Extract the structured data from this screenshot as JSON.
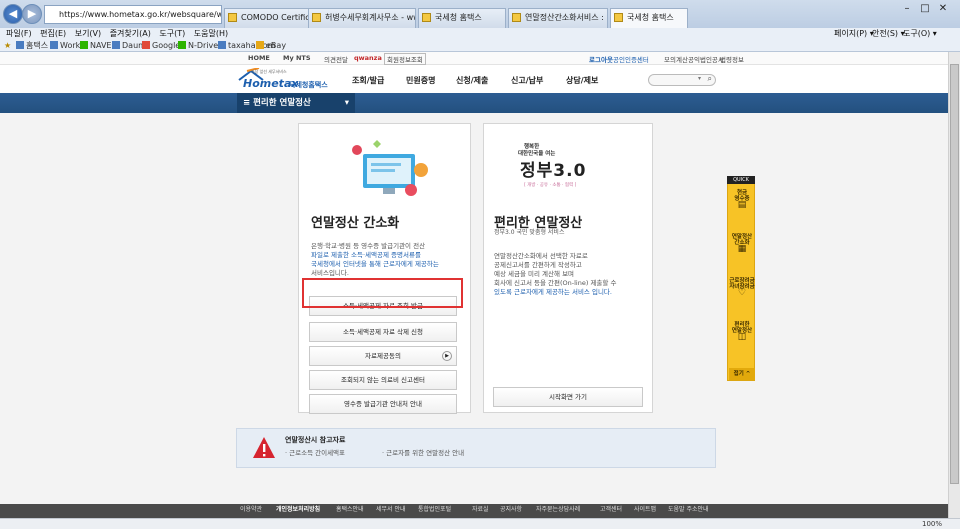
{
  "browser": {
    "address": "https://www.hometax.go.kr/websquare/websquare.wq?w",
    "tabs": [
      {
        "label": "COMODO Certification ..."
      },
      {
        "label": "허병수세무회계사무소 - www...."
      },
      {
        "label": "국세청 홈택스"
      },
      {
        "label": "연말정산간소화서비스 : 네이..."
      },
      {
        "label": "국세청 홈택스"
      }
    ],
    "menus": [
      "파일(F)",
      "편집(E)",
      "보기(V)",
      "즐겨찾기(A)",
      "도구(T)",
      "도움말(H)"
    ],
    "favorites": [
      "홈택스",
      "Works",
      "NAVER",
      "Daum",
      "Google",
      "N-Drive",
      "taxaha.com",
      "eBay"
    ],
    "tools": [
      "페이지(P) ▾",
      "안전(S) ▾",
      "도구(O) ▾"
    ],
    "zoom": "100%"
  },
  "site": {
    "top_links": {
      "home": "HOME",
      "mynts": "My NTS",
      "sitemap": "의견전달",
      "english": "qwanza",
      "member": "회원정보조회"
    },
    "top_right": {
      "logout": "로그아웃",
      "cert": "공인인증센터",
      "mock": "모의계산",
      "law": "공익법인공시",
      "notice": "법령정보"
    },
    "logo_text": "Hometax",
    "logo_sub": "국세청홈택스",
    "logo_tagline": "가장 앞선 세무서비스",
    "gnb": [
      "조회/발급",
      "민원증명",
      "신청/제출",
      "신고/납부",
      "상담/제보"
    ],
    "subnav_label": "≡  편리한 연말정산",
    "subnav_arrow": "▾",
    "quick_title": "QUICK",
    "quick_items": [
      "현금\n영수증",
      "연말정산\n간소화",
      "근로장려금\n자녀장려금",
      "편리한\n연말정산"
    ],
    "quick_close": "접기 ^",
    "card_left": {
      "title": "연말정산 간소화",
      "desc": [
        "은행·학교·병원 등 영수증 발급기관이 전산",
        "파일로 제출한 소득·세액공제 증명서류를",
        "국세청에서 인터넷을 통해 근로자에게 제공하는",
        "서비스입니다."
      ],
      "buttons": [
        "소득·세액공제 자료 조회 발급",
        "소득·세액공제 자료 삭제 신청",
        "자료제공동의",
        "조회되지 않는 의료비 신고센터",
        "영수증 발급기관 안내처 안내"
      ]
    },
    "card_right": {
      "banner_line1": "행복한",
      "banner_line2": "대한민국을 여는",
      "banner_big": "정부3.0",
      "banner_tags": "[ 개방 · 공유 · 소통 · 협력 ]",
      "title": "편리한 연말정산",
      "subtitle": "정부3.0 국민 맞춤형 서비스",
      "desc": [
        "연말정산간소화에서 선택한  자료로",
        "공제신고서를 간편하게 작성하고",
        "예상 세금을 미리 계산해 보며",
        "회사에 신고서 등을 간편(On-line) 제출할 수",
        "있도록 근로자에게 제공하는 서비스 입니다."
      ],
      "button": "시작화면 가기"
    },
    "reference": {
      "title": "연말정산시 참고자료",
      "items": [
        "· 근로소득 간이세액표",
        "· 근로자를 위한 연말정산 안내"
      ]
    },
    "footer": [
      "이용약관",
      "개인정보처리방침",
      "홈택스안내",
      "세무서 안내",
      "통합법인포털",
      "자료실",
      "공지사항",
      "자주묻는상담사례",
      "고객센터",
      "사이트맵",
      "도움말 주소안내"
    ]
  },
  "colors": {
    "brand": "#23507f",
    "accent": "#f7c326",
    "highlight": "#e03232"
  }
}
